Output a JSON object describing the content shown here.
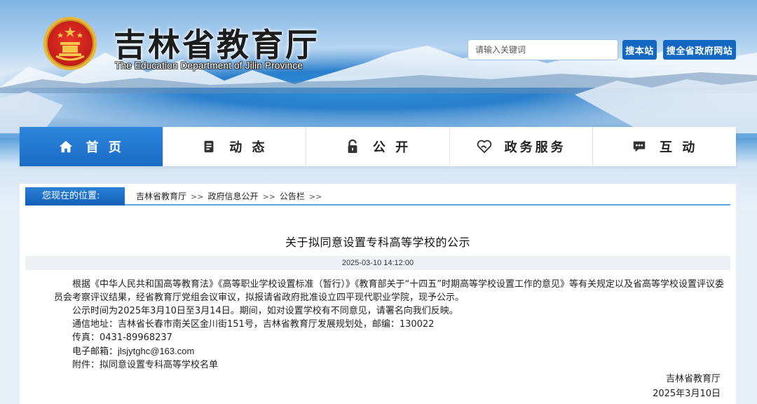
{
  "header": {
    "title": "吉林省教育厅",
    "subtitle": "The Education Department of Jilin Province",
    "search_placeholder": "请输入关键词",
    "btn_site_search": "搜本站",
    "btn_gov_search": "搜全省政府网站"
  },
  "nav": [
    {
      "label": "首 页",
      "icon": "home-icon",
      "active": true
    },
    {
      "label": "动 态",
      "icon": "document-icon",
      "active": false
    },
    {
      "label": "公 开",
      "icon": "lock-icon",
      "active": false
    },
    {
      "label": "政务服务",
      "icon": "heart-hands-icon",
      "active": false
    },
    {
      "label": "互 动",
      "icon": "chat-icon",
      "active": false
    }
  ],
  "breadcrumb": {
    "label": "您现在的位置:",
    "items": [
      "吉林省教育厅",
      "政府信息公开",
      "公告栏"
    ],
    "separator": ">>"
  },
  "article": {
    "title": "关于拟同意设置专科高等学校的公示",
    "datetime": "2025-03-10 14:12:00",
    "paragraph1": "根据《中华人民共和国高等教育法》《高等职业学校设置标准（暂行）》《教育部关于“十四五”时期高等学校设置工作的意见》等有关规定以及省高等学校设置评议委员会考察评议结果，经省教育厅党组会议审议，拟报请省政府批准设立四平现代职业学院，现予公示。",
    "paragraph2": "公示时间为2025年3月10日至3月14日。期间，如对设置学校有不同意见，请署名向我们反映。",
    "address": "通信地址：吉林省长春市南关区金川街151号，吉林省教育厅发展规划处，邮编：130022",
    "fax": "传真：0431-89968237",
    "email_label": "电子邮箱：",
    "email": "jlsjytghc@163.com",
    "attachment": "附件：拟同意设置专科高等学校名单",
    "signer": "吉林省教育厅",
    "sign_date": "2025年3月10日"
  },
  "colors": {
    "primary_blue": "#1a6bc4",
    "button_blue": "#1468c2",
    "breadcrumb_line": "#5aa6e8"
  }
}
